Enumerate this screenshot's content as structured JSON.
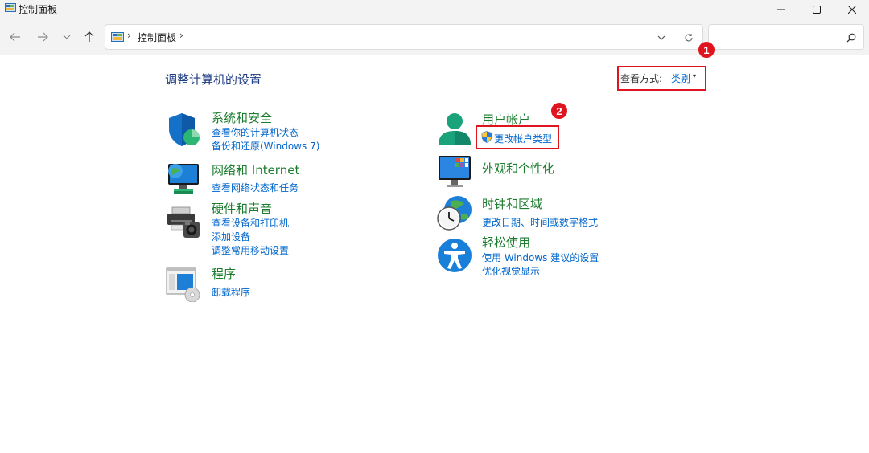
{
  "window": {
    "title": "控制面板"
  },
  "nav": {
    "breadcrumb_root": "控制面板",
    "search_placeholder": ""
  },
  "main": {
    "page_title": "调整计算机的设置",
    "view_by_label": "查看方式:",
    "view_by_value": "类别"
  },
  "annotations": {
    "badge_1": "1",
    "badge_2": "2"
  },
  "categories": {
    "system_security": {
      "title": "系统和安全",
      "links": [
        "查看你的计算机状态",
        "备份和还原(Windows 7)"
      ]
    },
    "network": {
      "title": "网络和 Internet",
      "links": [
        "查看网络状态和任务"
      ]
    },
    "hardware": {
      "title": "硬件和声音",
      "links": [
        "查看设备和打印机",
        "添加设备",
        "调整常用移动设置"
      ]
    },
    "programs": {
      "title": "程序",
      "links": [
        "卸载程序"
      ]
    },
    "user_accounts": {
      "title": "用户帐户",
      "links": [
        "更改帐户类型"
      ]
    },
    "appearance": {
      "title": "外观和个性化",
      "links": []
    },
    "clock_region": {
      "title": "时钟和区域",
      "links": [
        "更改日期、时间或数字格式"
      ]
    },
    "ease_access": {
      "title": "轻松使用",
      "links": [
        "使用 Windows 建议的设置",
        "优化视觉显示"
      ]
    }
  },
  "icons": {
    "app": "control-panel-icon",
    "back": "arrow-left-icon",
    "forward": "arrow-right-icon",
    "recent": "chevron-down-icon",
    "up": "arrow-up-icon",
    "refresh": "refresh-icon",
    "search": "search-icon",
    "uac": "uac-shield-icon"
  },
  "colors": {
    "highlight_red": "#e0141e",
    "category_green": "#1b7c2e",
    "link_blue": "#0066cc",
    "title_blue": "#1e3c84"
  }
}
